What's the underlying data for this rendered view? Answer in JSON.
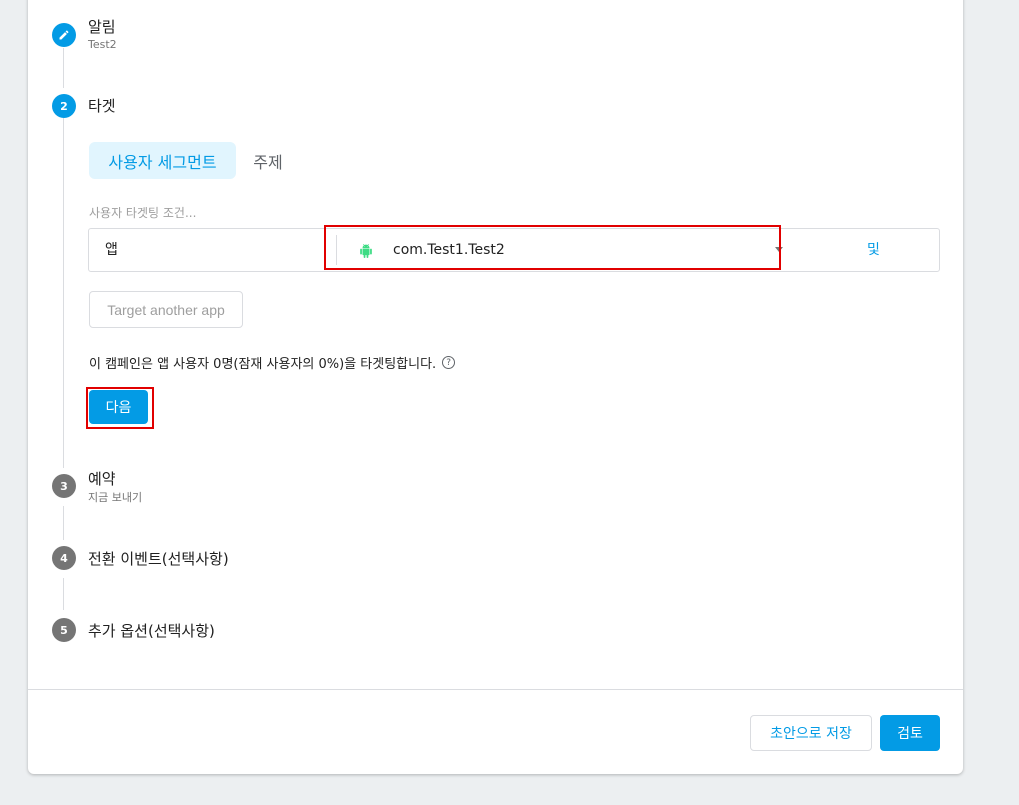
{
  "steps": [
    {
      "number": "",
      "title": "알림",
      "subtitle": "Test2",
      "state": "completed"
    },
    {
      "number": "2",
      "title": "타겟",
      "subtitle": "",
      "state": "active"
    },
    {
      "number": "3",
      "title": "예약",
      "subtitle": "지금 보내기",
      "state": "inactive"
    },
    {
      "number": "4",
      "title": "전환 이벤트(선택사항)",
      "subtitle": "",
      "state": "inactive"
    },
    {
      "number": "5",
      "title": "추가 옵션(선택사항)",
      "subtitle": "",
      "state": "inactive"
    }
  ],
  "target": {
    "tabs": [
      {
        "label": "사용자 세그먼트",
        "selected": true
      },
      {
        "label": "주제",
        "selected": false
      }
    ],
    "condition_label": "사용자 타겟팅 조건...",
    "condition": {
      "field": "앱",
      "value": "com.Test1.Test2",
      "value_icon": "android-icon",
      "and_label": "및"
    },
    "target_another_app": "Target another app",
    "reach_text": "이 캠페인은 앱 사용자 0명(잠재 사용자의 0%)을 타겟팅합니다.",
    "help_icon": "?",
    "next_label": "다음"
  },
  "footer": {
    "save_draft": "초안으로 저장",
    "review": "검토"
  },
  "colors": {
    "accent": "#039be5",
    "highlight": "#e10000",
    "background": "#eceff1"
  }
}
